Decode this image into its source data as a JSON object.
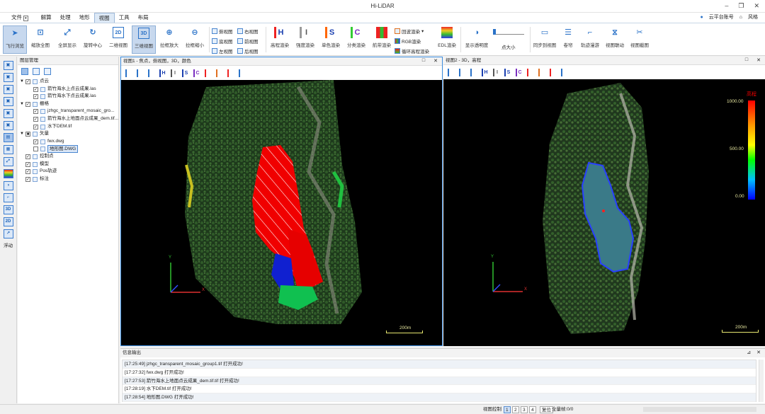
{
  "app": {
    "title": "Hi-LiDAR"
  },
  "menu": [
    {
      "label": "文件",
      "dropdown": "▾"
    },
    {
      "label": "解算"
    },
    {
      "label": "处理"
    },
    {
      "label": "地形"
    },
    {
      "label": "视图"
    },
    {
      "label": "工具"
    },
    {
      "label": "布局"
    }
  ],
  "account": {
    "cloud": "云平台账号",
    "style": "风格"
  },
  "ribbon": {
    "big": [
      "飞行浏览",
      "缩放全图",
      "全屏显示",
      "旋转中心",
      "二维视图",
      "三维视图",
      "拉框放大",
      "拉框缩小"
    ],
    "views_small": [
      "俯视图",
      "右视图",
      "底视图",
      "前视图",
      "左视图",
      "后视图"
    ],
    "render_big": [
      "高程渲染",
      "强度渲染",
      "单色渲染",
      "分类渲染",
      "航带渲染"
    ],
    "render_small": [
      "回波渲染",
      "RGB渲染",
      "循环高程渲染"
    ],
    "edl": "EDL渲染",
    "opacity": "显示透明度",
    "point_size": "点大小",
    "tail": [
      "同步到视图",
      "卷帘",
      "轨迹漫游",
      "视图联动",
      "视图截图"
    ]
  },
  "left_strip": {
    "float_label": "浮动"
  },
  "layer_panel": {
    "title": "图层管理",
    "tree": [
      {
        "label": "点云",
        "checked": "✓",
        "level": 0,
        "expand": "▼"
      },
      {
        "label": "箭竹海水上点云成果.las",
        "checked": "✓",
        "level": 1
      },
      {
        "label": "箭竹海水下点云成果.las",
        "checked": "✓",
        "level": 1
      },
      {
        "label": "栅格",
        "checked": "✓",
        "level": 0,
        "expand": "▼"
      },
      {
        "label": "jzhgc_transparent_mosaic_gro...",
        "checked": "✓",
        "level": 1
      },
      {
        "label": "箭竹海水上地面点云成果_dem.tif...",
        "checked": "✓",
        "level": 1
      },
      {
        "label": "水下DEM.tif",
        "checked": "✓",
        "level": 1
      },
      {
        "label": "矢量",
        "checked": "■",
        "level": 0,
        "expand": "▼"
      },
      {
        "label": "fwx.dwg",
        "checked": "✓",
        "level": 1
      },
      {
        "label": "地形图.DWG",
        "checked": "",
        "level": 1,
        "selected": true
      },
      {
        "label": "控制点",
        "checked": "✓",
        "level": 0
      },
      {
        "label": "模型",
        "checked": "✓",
        "level": 0
      },
      {
        "label": "Pos轨迹",
        "checked": "✓",
        "level": 0
      },
      {
        "label": "标注",
        "checked": "✓",
        "level": 0
      }
    ]
  },
  "viewport1": {
    "title": "视图1 - 焦点，俯视图，3D，颜色",
    "scale": "200m",
    "axis_x": "X",
    "axis_y": "Y"
  },
  "viewport2": {
    "title": "视图2 - 3D，高程",
    "scale": "200m",
    "legend_title": "高程",
    "legend_values": [
      "1000.00",
      "500.00",
      "0.00"
    ],
    "axis_x": "X",
    "axis_y": "Y"
  },
  "vp_tool_letters": [
    "",
    "",
    "",
    "H",
    "I",
    "S",
    "C",
    "",
    "",
    "",
    ""
  ],
  "output": {
    "title": "信息输出",
    "lines": [
      "[17:25:49] jzhgc_transparent_mosaic_group1.tif 打开成功!",
      "[17:27:32] fwx.dwg 打开成功!",
      "[17:27:53] 箭竹海水上地面点云成果_dem.tif.tif 打开成功!",
      "[17:28:19] 水下DEM.tif 打开成功!",
      "[17:28:54] 地形图.DWG 打开成功!"
    ]
  },
  "status": {
    "view_control": "视图控制",
    "pages": [
      "1",
      "2",
      "3",
      "4"
    ],
    "reset": "复位",
    "selected": "全量帧:0/0"
  },
  "colors": {
    "accent": "#2a72c8",
    "selection": "#4a86cf",
    "legend_red": "#e00000"
  }
}
